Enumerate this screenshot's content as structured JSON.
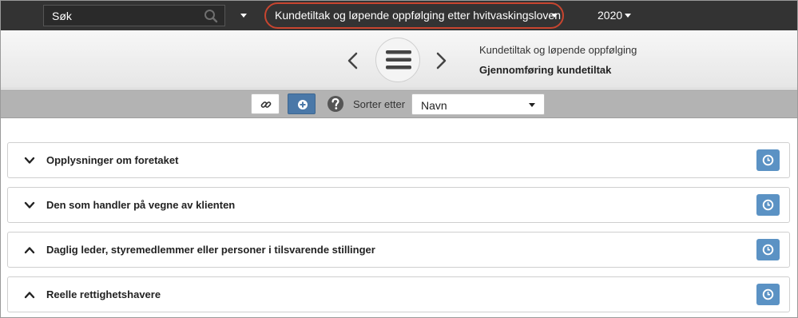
{
  "topbar": {
    "search_placeholder": "Søk",
    "title": "Kundetiltak og løpende oppfølging etter hvitvaskingsloven",
    "year": "2020"
  },
  "header": {
    "line1": "Kundetiltak og løpende oppfølging",
    "line2": "Gjennomføring kundetiltak"
  },
  "toolbar": {
    "sort_label": "Sorter etter",
    "sort_value": "Navn"
  },
  "sections": [
    {
      "title": "Opplysninger om foretaket",
      "expanded": false
    },
    {
      "title": "Den som handler på vegne av klienten",
      "expanded": false
    },
    {
      "title": "Daglig leder, styremedlemmer eller personer i tilsvarende stillinger",
      "expanded": true
    },
    {
      "title": "Reelle rettighetshavere",
      "expanded": true
    }
  ],
  "colors": {
    "topbar_bg": "#333333",
    "highlight_ring": "#c8452f",
    "add_button": "#4a78a8",
    "history_button": "#5b92c4"
  }
}
